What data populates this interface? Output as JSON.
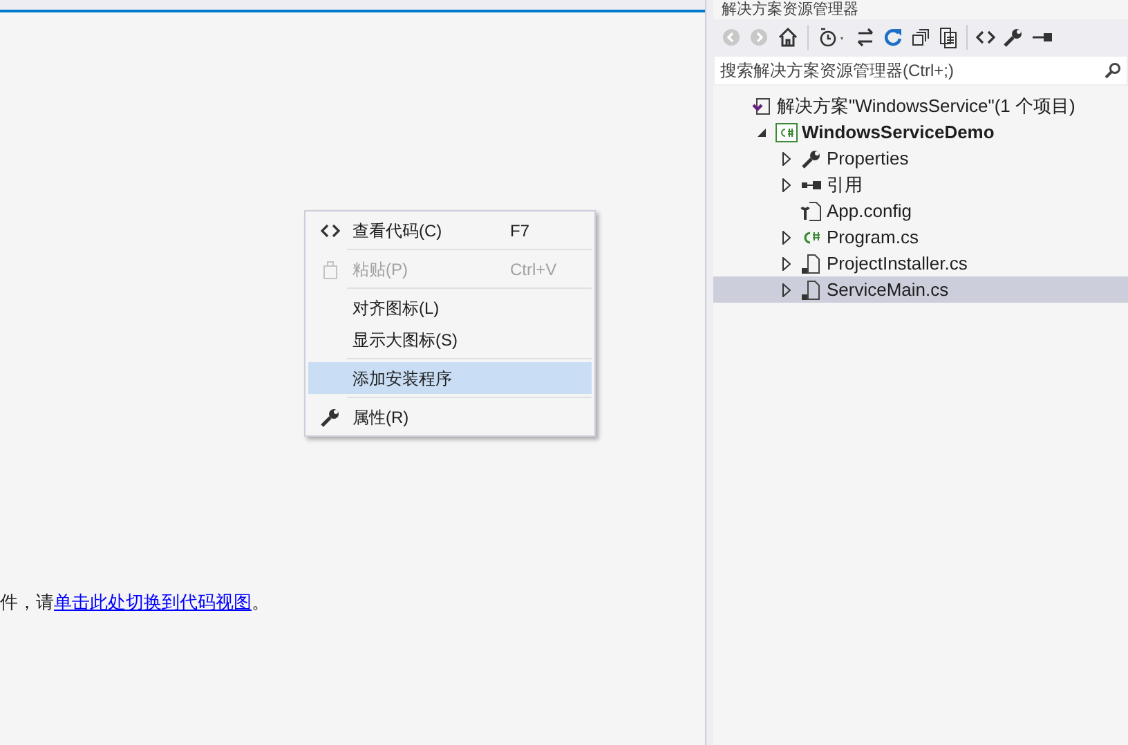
{
  "designer": {
    "hint_before": "件，请",
    "hint_link": "单击此处切换到代码视图",
    "hint_after": "。"
  },
  "context_menu": [
    {
      "kind": "code",
      "label": "查看代码(C)",
      "shortcut": "F7",
      "disabled": false,
      "selected": false
    },
    {
      "kind": "separator"
    },
    {
      "kind": "paste",
      "label": "粘贴(P)",
      "shortcut": "Ctrl+V",
      "disabled": true,
      "selected": false
    },
    {
      "kind": "separator"
    },
    {
      "kind": "plain",
      "label": "对齐图标(L)",
      "disabled": false,
      "selected": false
    },
    {
      "kind": "plain",
      "label": "显示大图标(S)",
      "disabled": false,
      "selected": false
    },
    {
      "kind": "separator"
    },
    {
      "kind": "plain",
      "label": "添加安装程序",
      "disabled": false,
      "selected": true
    },
    {
      "kind": "separator"
    },
    {
      "kind": "wrench",
      "label": "属性(R)",
      "disabled": false,
      "selected": false
    }
  ],
  "solution_explorer": {
    "title": "解决方案资源管理器",
    "search": {
      "placeholder": "搜索解决方案资源管理器(Ctrl+;)"
    },
    "tree": [
      {
        "kind": "solution",
        "label": "解决方案\"WindowsService\"(1 个项目)",
        "selected": false,
        "children": [
          {
            "kind": "project",
            "label": "WindowsServiceDemo",
            "expanded": true,
            "selected": false,
            "children": [
              {
                "kind": "properties",
                "label": "Properties",
                "expanded": false,
                "selected": false
              },
              {
                "kind": "references",
                "label": "引用",
                "expanded": false,
                "selected": false
              },
              {
                "kind": "config",
                "label": "App.config",
                "selected": false
              },
              {
                "kind": "csharp",
                "label": "Program.cs",
                "expanded": false,
                "selected": false
              },
              {
                "kind": "component",
                "label": "ProjectInstaller.cs",
                "expanded": false,
                "selected": false
              },
              {
                "kind": "component",
                "label": "ServiceMain.cs",
                "expanded": false,
                "selected": true
              }
            ]
          }
        ]
      }
    ]
  }
}
